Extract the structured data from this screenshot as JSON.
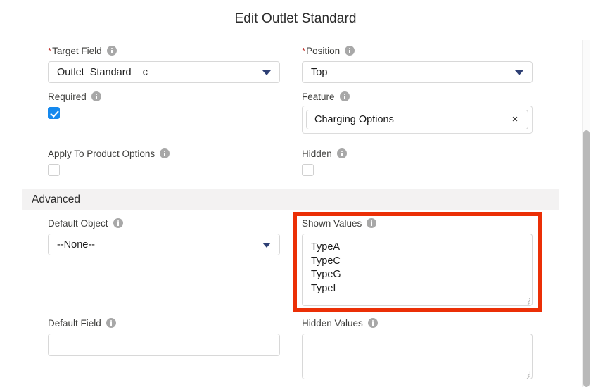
{
  "header": {
    "title": "Edit Outlet Standard"
  },
  "form": {
    "target_field": {
      "label": "Target Field",
      "required_marker": "*",
      "value": "Outlet_Standard__c",
      "info_tooltip": "info-icon"
    },
    "position": {
      "label": "Position",
      "required_marker": "*",
      "value": "Top"
    },
    "required": {
      "label": "Required",
      "checked": true
    },
    "feature": {
      "label": "Feature",
      "value": "Charging Options",
      "clear_label": "×"
    },
    "apply_to_product_options": {
      "label": "Apply To Product Options",
      "checked": false
    },
    "hidden": {
      "label": "Hidden",
      "checked": false
    }
  },
  "advanced": {
    "section_title": "Advanced",
    "default_object": {
      "label": "Default Object",
      "value": "--None--"
    },
    "shown_values": {
      "label": "Shown Values",
      "value": "TypeA\nTypeC\nTypeG\nTypeI"
    },
    "default_field": {
      "label": "Default Field",
      "value": ""
    },
    "hidden_values": {
      "label": "Hidden Values",
      "value": ""
    }
  },
  "annotation": {
    "color": "#eb2f06",
    "target": "shown-values-field"
  },
  "colors": {
    "accent_blue": "#1589ee",
    "dropdown_arrow": "#2d3f74",
    "required_star": "#c23934",
    "section_bg": "#f3f2f2",
    "border": "#d8d8d8"
  }
}
